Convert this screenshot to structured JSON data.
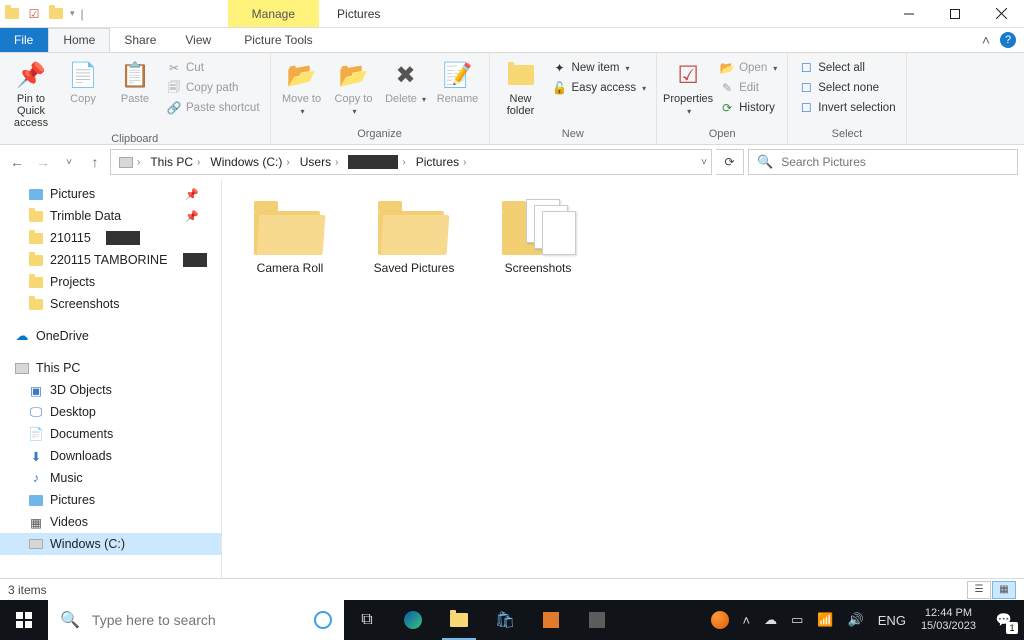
{
  "window": {
    "context_tab": "Manage",
    "title": "Pictures",
    "tools_tab": "Picture Tools"
  },
  "tabs": {
    "file": "File",
    "home": "Home",
    "share": "Share",
    "view": "View"
  },
  "ribbon": {
    "clipboard": {
      "label": "Clipboard",
      "pin": "Pin to Quick access",
      "copy": "Copy",
      "paste": "Paste",
      "cut": "Cut",
      "copy_path": "Copy path",
      "paste_shortcut": "Paste shortcut"
    },
    "organize": {
      "label": "Organize",
      "move_to": "Move to",
      "copy_to": "Copy to",
      "delete": "Delete",
      "rename": "Rename"
    },
    "new": {
      "label": "New",
      "new_folder": "New folder",
      "new_item": "New item",
      "easy_access": "Easy access"
    },
    "open": {
      "label": "Open",
      "properties": "Properties",
      "open": "Open",
      "edit": "Edit",
      "history": "History"
    },
    "select": {
      "label": "Select",
      "select_all": "Select all",
      "select_none": "Select none",
      "invert": "Invert selection"
    }
  },
  "breadcrumb": {
    "this_pc": "This PC",
    "drive": "Windows (C:)",
    "users": "Users",
    "pictures": "Pictures"
  },
  "search": {
    "placeholder": "Search Pictures"
  },
  "nav": {
    "pictures": "Pictures",
    "trimble": "Trimble Data",
    "f210115": "210115",
    "f220115": "220115 TAMBORINE",
    "projects": "Projects",
    "screenshots": "Screenshots",
    "onedrive": "OneDrive",
    "this_pc": "This PC",
    "objects3d": "3D Objects",
    "desktop": "Desktop",
    "documents": "Documents",
    "downloads": "Downloads",
    "music": "Music",
    "pictures2": "Pictures",
    "videos": "Videos",
    "windows_c": "Windows (C:)"
  },
  "items": {
    "camera_roll": "Camera Roll",
    "saved_pictures": "Saved Pictures",
    "screenshots": "Screenshots"
  },
  "status": {
    "count": "3 items"
  },
  "taskbar": {
    "search_placeholder": "Type here to search",
    "lang": "ENG",
    "time": "12:44 PM",
    "date": "15/03/2023",
    "notif_count": "1"
  }
}
